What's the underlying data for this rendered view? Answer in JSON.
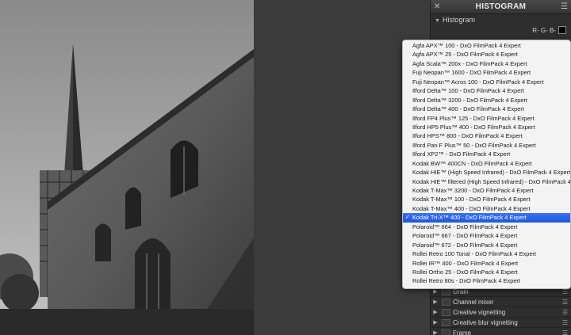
{
  "panel": {
    "title": "HISTOGRAM",
    "section_label": "Histogram",
    "channels_label": "R- G- B-"
  },
  "filmpack_options": [
    "Agfa APX™ 100 - DxO FilmPack 4 Expert",
    "Agfa APX™ 25 - DxO FilmPack 4 Expert",
    "Agfa Scala™ 200x - DxO FilmPack 4 Expert",
    "Fuji Neopan™ 1600 - DxO FilmPack 4 Expert",
    "Fuji Neopan™ Acros 100 - DxO FilmPack 4 Expert",
    "Ilford Delta™ 100 - DxO FilmPack 4 Expert",
    "Ilford Delta™ 3200 - DxO FilmPack 4 Expert",
    "Ilford Delta™ 400 - DxO FilmPack 4 Expert",
    "Ilford FP4 Plus™ 125 - DxO FilmPack 4 Expert",
    "Ilford HP5 Plus™ 400 - DxO FilmPack 4 Expert",
    "Ilford HPS™ 800 - DxO FilmPack 4 Expert",
    "Ilford Pan F Plus™ 50 - DxO FilmPack 4 Expert",
    "Ilford XP2™ - DxO FilmPack 4 Expert",
    "Kodak BW™ 400CN - DxO FilmPack 4 Expert",
    "Kodak HIE™ (High Speed Infrared) - DxO FilmPack 4 Expert",
    "Kodak HIE™ filtered (High Speed Infrared) - DxO FilmPack 4 Expert",
    "Kodak T-Max™ 3200 - DxO FilmPack 4 Expert",
    "Kodak T-Max™ 100 - DxO FilmPack 4 Expert",
    "Kodak T-Max™ 400 - DxO FilmPack 4 Expert",
    "Kodak Tri-X™ 400 - DxO FilmPack 4 Expert",
    "Polaroid™ 664 - DxO FilmPack 4 Expert",
    "Polaroid™ 667 - DxO FilmPack 4 Expert",
    "Polaroid™ 672 - DxO FilmPack 4 Expert",
    "Rollei Retro 100 Tonal - DxO FilmPack 4 Expert",
    "Rollei IR™ 400 - DxO FilmPack 4 Expert",
    "Rollei Ortho 25 - DxO FilmPack 4 Expert",
    "Rollei Retro 80s - DxO FilmPack 4 Expert"
  ],
  "selected_option": "Kodak Tri-X™ 400 - DxO FilmPack 4 Expert",
  "check_glyph": "✓",
  "tool_rows": [
    {
      "label": "Grain"
    },
    {
      "label": "Channel mixer"
    },
    {
      "label": "Creative vignetting"
    },
    {
      "label": "Creative blur vignetting"
    },
    {
      "label": "Frame"
    }
  ],
  "icons": [
    "close-icon",
    "panel-menu-icon",
    "collapse-triangle-icon",
    "expand-arrow-icon",
    "checkmark-icon"
  ],
  "colors": {
    "selection": "#1c56e0",
    "panel_bg": "#2e2e2e",
    "menu_bg": "#f3f3f3"
  }
}
